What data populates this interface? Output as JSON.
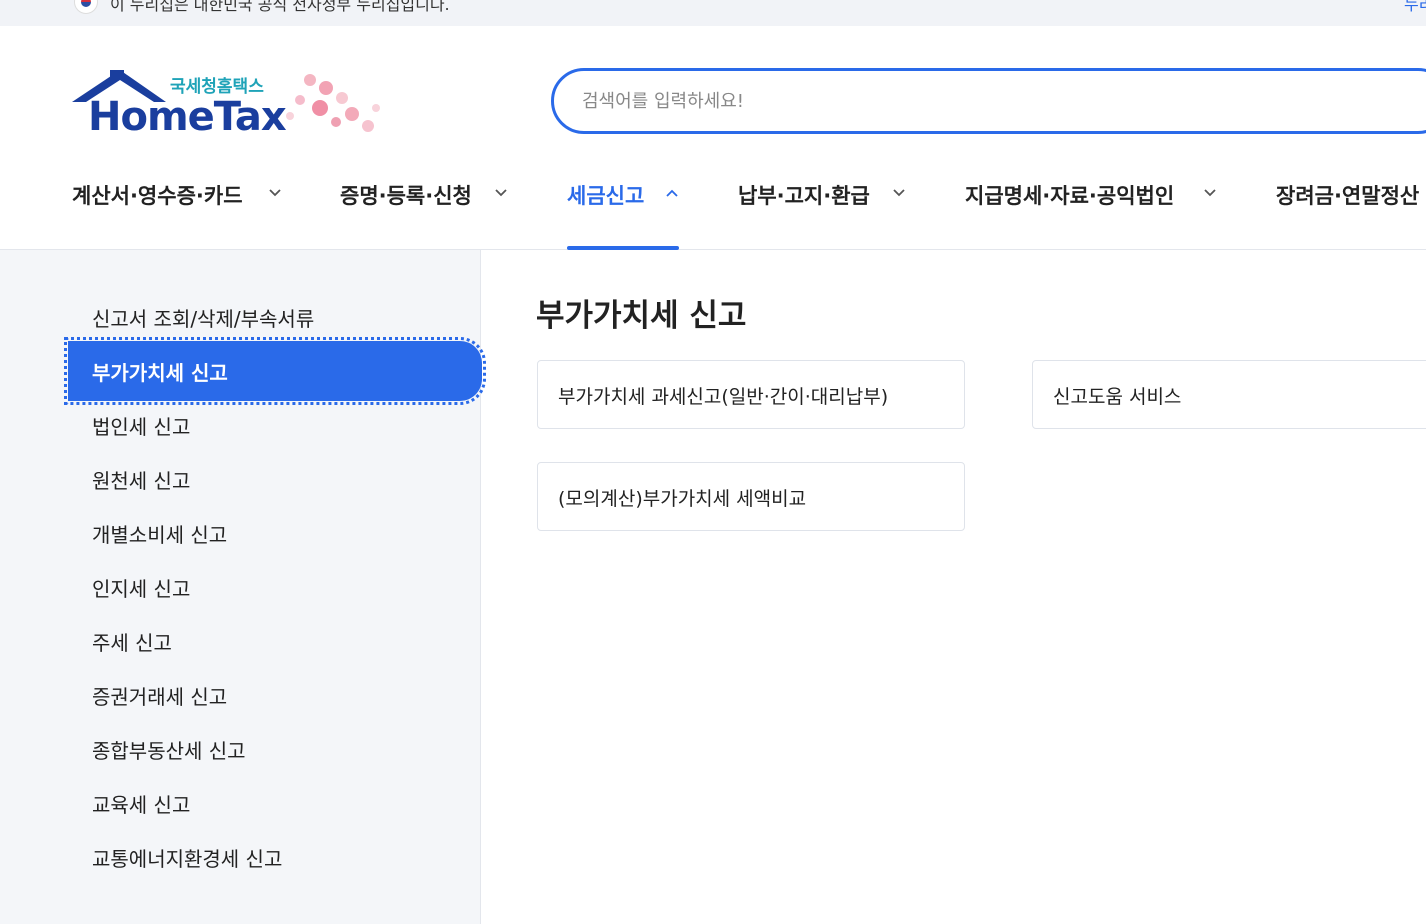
{
  "topbar": {
    "notice": "이 누리집은 대한민국 공식 전자정부 누리집입니다.",
    "right_link": "누리"
  },
  "logo": {
    "korean": "국세청홈택스",
    "brand": "HomeTax"
  },
  "search": {
    "placeholder": "검색어를 입력하세요!"
  },
  "nav": {
    "items": [
      {
        "label": "계산서·영수증·카드"
      },
      {
        "label": "증명·등록·신청"
      },
      {
        "label": "세금신고"
      },
      {
        "label": "납부·고지·환급"
      },
      {
        "label": "지급명세·자료·공익법인"
      },
      {
        "label": "장려금·연말정산"
      }
    ],
    "active": "세금신고"
  },
  "sidebar": {
    "items": [
      {
        "label": "신고서 조회/삭제/부속서류"
      },
      {
        "label": "부가가치세 신고"
      },
      {
        "label": "법인세 신고"
      },
      {
        "label": "원천세 신고"
      },
      {
        "label": "개별소비세 신고"
      },
      {
        "label": "인지세 신고"
      },
      {
        "label": "주세 신고"
      },
      {
        "label": "증권거래세 신고"
      },
      {
        "label": "종합부동산세 신고"
      },
      {
        "label": "교육세 신고"
      },
      {
        "label": "교통에너지환경세 신고"
      }
    ],
    "active": "부가가치세 신고"
  },
  "main": {
    "title": "부가가치세 신고",
    "cards": [
      {
        "label": "부가가치세 과세신고(일반·간이·대리납부)"
      },
      {
        "label": "신고도움 서비스"
      },
      {
        "label": "(모의계산)부가가치세 세액비교"
      }
    ]
  },
  "colors": {
    "accent": "#2a6ae9",
    "brand": "#1a3e9e",
    "sidebar_bg": "#f4f6f9"
  }
}
